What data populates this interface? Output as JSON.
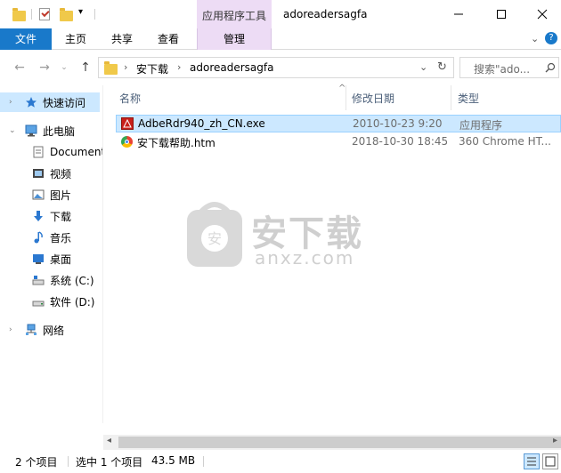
{
  "window": {
    "title": "adoreadersagfa",
    "contextual_tab_group": "应用程序工具",
    "minimize_icon": "minimize-icon",
    "maximize_icon": "maximize-icon",
    "close_icon": "close-icon"
  },
  "ribbon": {
    "tabs": [
      {
        "label": "文件"
      },
      {
        "label": "主页"
      },
      {
        "label": "共享"
      },
      {
        "label": "查看"
      },
      {
        "label": "管理"
      }
    ]
  },
  "address_bar": {
    "breadcrumbs": [
      "安下载",
      "adoreadersagfa"
    ],
    "search_placeholder": "搜索\"ado..."
  },
  "nav_pane": {
    "items": [
      {
        "label": "快速访问",
        "icon": "star-icon"
      },
      {
        "label": "此电脑",
        "icon": "computer-icon"
      },
      {
        "label": "Documents",
        "icon": "documents-icon"
      },
      {
        "label": "视频",
        "icon": "video-icon"
      },
      {
        "label": "图片",
        "icon": "pictures-icon"
      },
      {
        "label": "下载",
        "icon": "download-icon"
      },
      {
        "label": "音乐",
        "icon": "music-icon"
      },
      {
        "label": "桌面",
        "icon": "desktop-icon"
      },
      {
        "label": "系统 (C:)",
        "icon": "drive-c-icon"
      },
      {
        "label": "软件 (D:)",
        "icon": "drive-d-icon"
      },
      {
        "label": "网络",
        "icon": "network-icon"
      }
    ]
  },
  "file_list": {
    "columns": [
      "名称",
      "修改日期",
      "类型"
    ],
    "rows": [
      {
        "name": "AdbeRdr940_zh_CN.exe",
        "date": "2010-10-23 9:20",
        "type": "应用程序",
        "icon": "adobe-reader-icon",
        "selected": true
      },
      {
        "name": "安下载帮助.htm",
        "date": "2018-10-30 18:45",
        "type": "360 Chrome HT...",
        "icon": "chrome-html-icon",
        "selected": false
      }
    ]
  },
  "watermark": {
    "brand": "安下载",
    "domain": "anxz.com"
  },
  "status_bar": {
    "item_count": "2 个项目",
    "selection": "选中 1 个项目",
    "size": "43.5 MB"
  }
}
